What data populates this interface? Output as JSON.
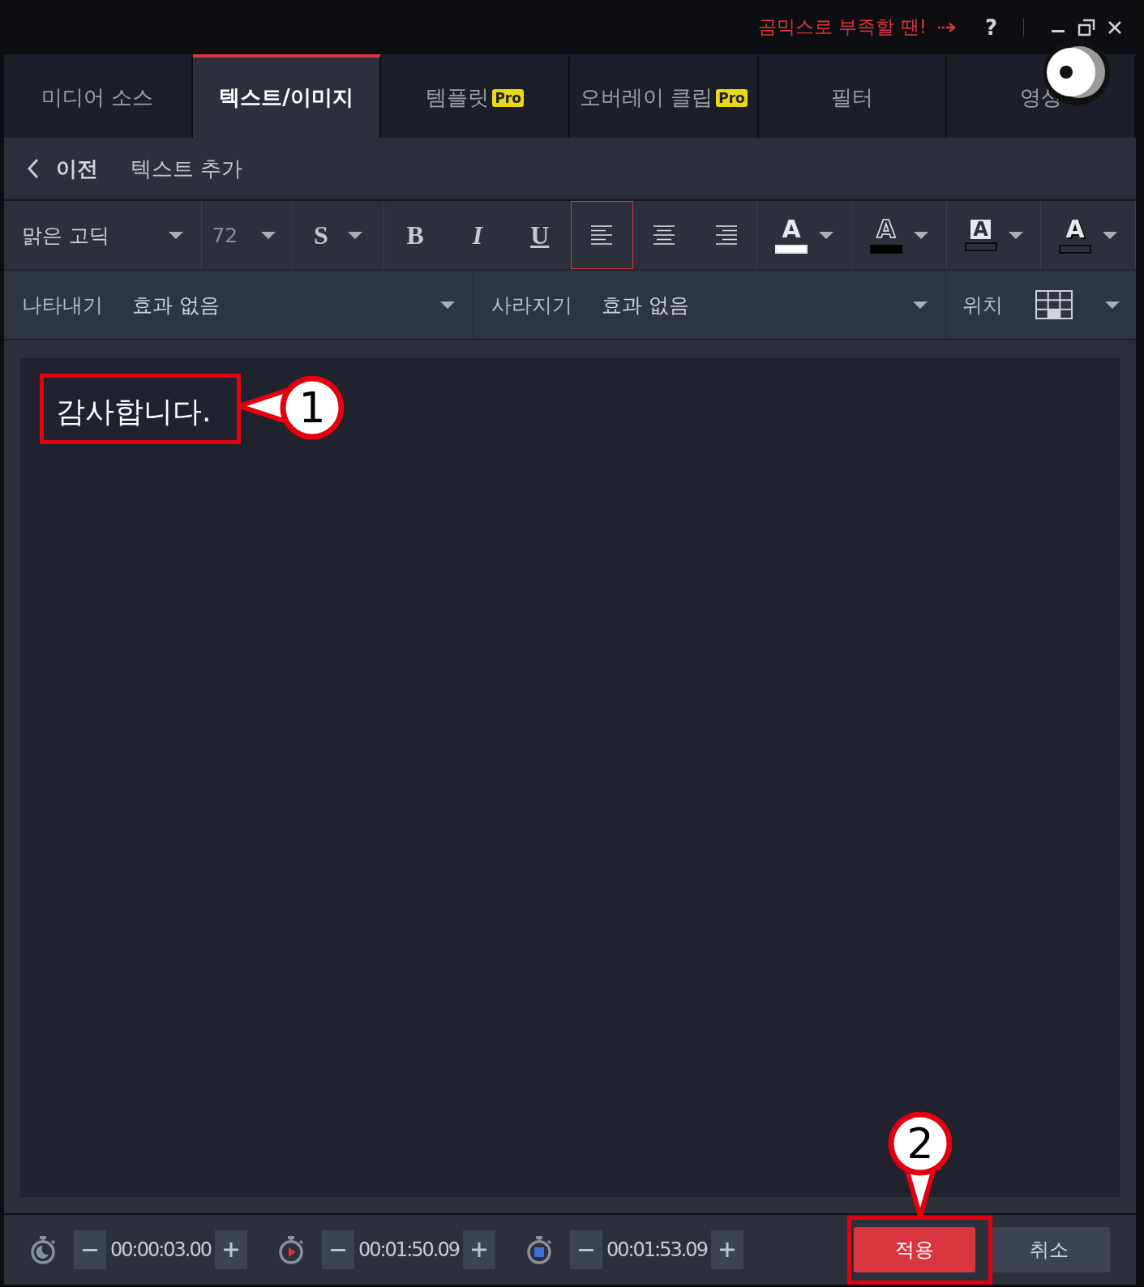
{
  "title_bar": {
    "promo": "곰믹스로 부족할 땐!",
    "help": "?"
  },
  "tabs": [
    {
      "label": "미디어 소스",
      "selected": false,
      "pro": false
    },
    {
      "label": "텍스트/이미지",
      "selected": true,
      "pro": false
    },
    {
      "label": "템플릿",
      "selected": false,
      "pro": "Pro"
    },
    {
      "label": "오버레이 클립",
      "selected": false,
      "pro": "Pro"
    },
    {
      "label": "필터",
      "selected": false,
      "pro": false
    },
    {
      "label": "영상",
      "selected": false,
      "pro": false
    }
  ],
  "nav": {
    "back": "이전",
    "title": "텍스트 추가"
  },
  "toolbar": {
    "font": "맑은 고딕",
    "size": "72",
    "styles": [
      {
        "kind": "strike",
        "label": "S",
        "dropdown": true
      },
      {
        "kind": "bold",
        "label": "B",
        "dropdown": false
      },
      {
        "kind": "italic",
        "label": "I",
        "dropdown": false
      },
      {
        "kind": "underline",
        "label": "U",
        "dropdown": false
      }
    ],
    "align": [
      {
        "kind": "left",
        "selected": true
      },
      {
        "kind": "center",
        "selected": false
      },
      {
        "kind": "right",
        "selected": false
      }
    ],
    "colors": [
      {
        "kind": "plain",
        "label": "A",
        "color": "#ffffff"
      },
      {
        "kind": "outline",
        "label": "A",
        "color": "#000000"
      },
      {
        "kind": "boxed",
        "label": "A",
        "color": "#2b303b"
      },
      {
        "kind": "shadow",
        "label": "A",
        "color": "#2b303b"
      }
    ]
  },
  "effects": {
    "appear_label": "나타내기",
    "appear_value": "효과 없음",
    "disappear_label": "사라지기",
    "disappear_value": "효과 없음",
    "position_label": "위치"
  },
  "editor": {
    "text": "감사합니다."
  },
  "timing": [
    {
      "kind": "duration",
      "value": "00:00:03.00"
    },
    {
      "kind": "start",
      "value": "00:01:50.09"
    },
    {
      "kind": "end",
      "value": "00:01:53.09"
    }
  ],
  "buttons": [
    {
      "kind": "primary",
      "label": "적용"
    },
    {
      "kind": "secondary",
      "label": "취소"
    }
  ],
  "annotations": [
    {
      "kind": "left",
      "number": "1"
    },
    {
      "kind": "down",
      "number": "2"
    }
  ]
}
